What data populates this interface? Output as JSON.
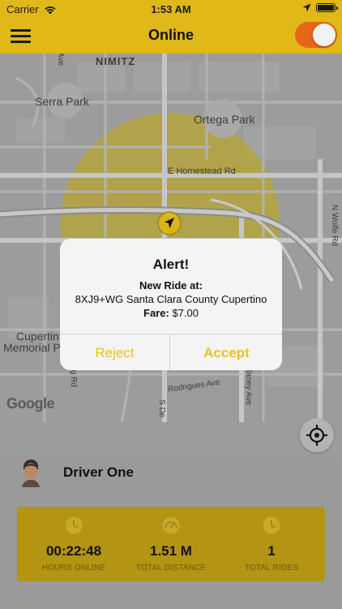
{
  "status_bar": {
    "carrier": "Carrier",
    "time": "1:53 AM",
    "icons": [
      "wifi-icon",
      "location-arrow-icon",
      "battery-icon"
    ]
  },
  "nav": {
    "title": "Online",
    "menu_icon": "hamburger-menu-icon",
    "online_toggle": {
      "on": true,
      "color": "#e8661a"
    }
  },
  "map": {
    "labels": {
      "nimitz": "NIMITZ",
      "serra_park": "Serra Park",
      "ortega_park": "Ortega Park",
      "homestead": "E Homestead Rd",
      "wolfe": "N Wolfe Rd",
      "cupertino_memorial_1": "Cupertin",
      "cupertino_memorial_2": "Memorial P",
      "rodrigues": "Rodrigues Ave",
      "stelling": "telling Rd",
      "blaney": "laney Ave",
      "sde": "S De",
      "ave_top": "Ave",
      "google": "Google"
    },
    "location_marker_icon": "navigation-arrow-icon",
    "recenter_icon": "crosshair-icon"
  },
  "alert": {
    "title": "Alert!",
    "line1": "New Ride at:",
    "address": "8XJ9+WG Santa Clara County Cupertino",
    "fare_label": "Fare:",
    "fare_value": "$7.00",
    "reject_label": "Reject",
    "accept_label": "Accept"
  },
  "driver": {
    "name": "Driver One",
    "avatar_icon": "driver-avatar"
  },
  "stats": [
    {
      "value": "00:22:48",
      "label": "HOURS ONLINE",
      "icon": "clock-icon"
    },
    {
      "value": "1.51 M",
      "label": "TOTAL DISTANCE",
      "icon": "speedometer-icon"
    },
    {
      "value": "1",
      "label": "TOTAL RIDES",
      "icon": "clock-icon"
    }
  ],
  "colors": {
    "brand_yellow": "#e0b818",
    "stats_card": "#b39413",
    "toggle_orange": "#e8661a",
    "alert_button": "#e8c31e"
  }
}
